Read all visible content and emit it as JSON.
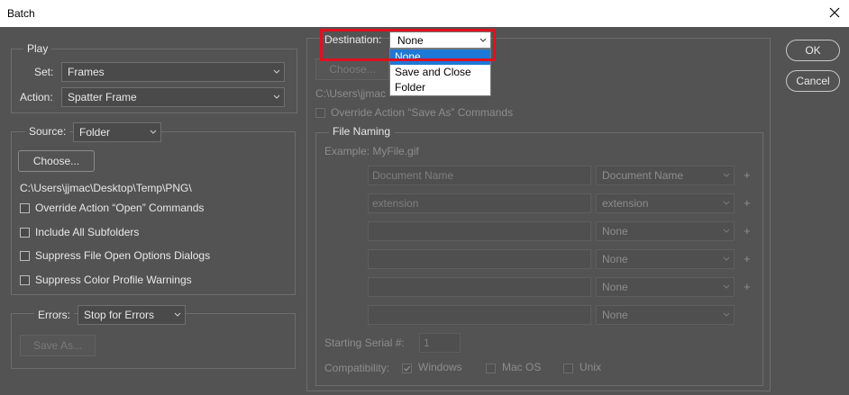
{
  "window": {
    "title": "Batch"
  },
  "play": {
    "legend": "Play",
    "set_label": "Set:",
    "set_value": "Frames",
    "action_label": "Action:",
    "action_value": "Spatter Frame"
  },
  "source": {
    "label": "Source:",
    "value": "Folder",
    "choose_label": "Choose...",
    "path": "C:\\Users\\jjmac\\Desktop\\Temp\\PNG\\",
    "checkboxes": [
      "Override Action “Open” Commands",
      "Include All Subfolders",
      "Suppress File Open Options Dialogs",
      "Suppress Color Profile Warnings"
    ]
  },
  "errors": {
    "label": "Errors:",
    "value": "Stop for Errors",
    "save_as_label": "Save As..."
  },
  "destination": {
    "label": "Destination:",
    "value": "None",
    "options": [
      "None",
      "Save and Close",
      "Folder"
    ],
    "selected_option": "None",
    "choose_label": "Choose...",
    "path_visible": "C:\\Users\\jjmac",
    "override_label": "Override Action “Save As” Commands"
  },
  "file_naming": {
    "legend": "File Naming",
    "example": "Example: MyFile.gif",
    "rows": [
      {
        "field": "Document Name",
        "select": "Document Name"
      },
      {
        "field": "extension",
        "select": "extension"
      },
      {
        "field": "",
        "select": "None"
      },
      {
        "field": "",
        "select": "None"
      },
      {
        "field": "",
        "select": "None"
      },
      {
        "field": "",
        "select": "None"
      }
    ],
    "serial_label": "Starting Serial #:",
    "serial_value": "1",
    "compat_label": "Compatibility:",
    "compat_options": [
      "Windows",
      "Mac OS",
      "Unix"
    ]
  },
  "buttons": {
    "ok": "OK",
    "cancel": "Cancel"
  }
}
